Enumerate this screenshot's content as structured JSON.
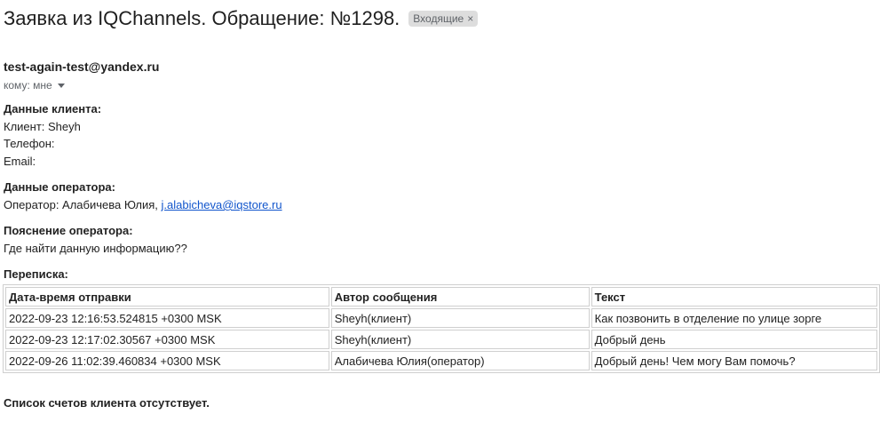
{
  "email": {
    "subject": "Заявка из IQChannels. Обращение: №1298.",
    "label": "Входящие",
    "label_close": "×",
    "sender": "test-again-test@yandex.ru",
    "recipient": "кому: мне"
  },
  "client": {
    "heading": "Данные клиента:",
    "client_line": "Клиент: Sheyh",
    "phone_line": "Телефон:",
    "email_line": "Email:"
  },
  "operator": {
    "heading": "Данные оператора:",
    "operator_prefix": "Оператор: Алабичева Юлия,",
    "operator_email": "j.alabicheva@iqstore.ru"
  },
  "operator_note": {
    "heading": "Пояснение оператора:",
    "text": "Где найти данную информацию??"
  },
  "correspondence": {
    "heading": "Переписка:",
    "columns": [
      "Дата-время отправки",
      "Автор сообщения",
      "Текст"
    ],
    "rows": [
      [
        "2022-09-23 12:16:53.524815 +0300 MSK",
        "Sheyh(клиент)",
        "Как позвонить в отделение по улице зорге"
      ],
      [
        "2022-09-23 12:17:02.30567 +0300 MSK",
        "Sheyh(клиент)",
        "Добрый день"
      ],
      [
        "2022-09-26 11:02:39.460834 +0300 MSK",
        "Алабичева Юлия(оператор)",
        "Добрый день! Чем могу Вам помочь?"
      ]
    ]
  },
  "footer": {
    "accounts_text": "Список счетов клиента отсутствует."
  }
}
